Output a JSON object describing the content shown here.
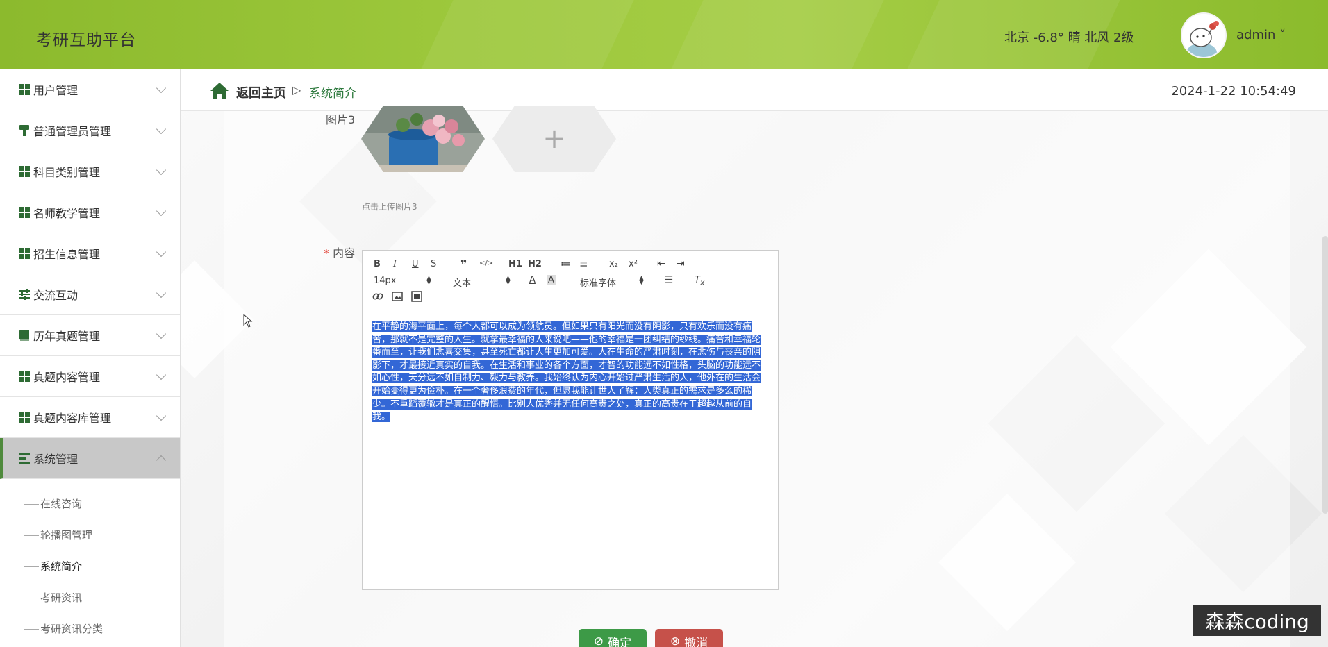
{
  "header": {
    "site_title": "考研互助平台",
    "weather": "北京  -6.8°  晴  北风  2级",
    "user_name": "admin ˅"
  },
  "sidebar": {
    "items": [
      {
        "label": "用户管理",
        "icon": "grid-icon"
      },
      {
        "label": "普通管理员管理",
        "icon": "brush-icon"
      },
      {
        "label": "科目类别管理",
        "icon": "grid-icon"
      },
      {
        "label": "名师教学管理",
        "icon": "grid-icon"
      },
      {
        "label": "招生信息管理",
        "icon": "grid-icon"
      },
      {
        "label": "交流互动",
        "icon": "sliders-icon"
      },
      {
        "label": "历年真题管理",
        "icon": "book-icon"
      },
      {
        "label": "真题内容管理",
        "icon": "grid-icon"
      },
      {
        "label": "真题内容库管理",
        "icon": "grid-icon"
      },
      {
        "label": "系统管理",
        "icon": "list-icon"
      }
    ],
    "submenu": [
      "在线咨询",
      "轮播图管理",
      "系统简介",
      "考研资讯",
      "考研资讯分类"
    ]
  },
  "breadcrumb": {
    "home": "返回主页",
    "separator": "▷",
    "current": "系统简介"
  },
  "datetime": "2024-1-22 10:54:49",
  "form": {
    "image3_label": "图片3",
    "upload_plus": "+",
    "upload_hint": "点击上传图片3",
    "content_label": "内容",
    "required_mark": "*"
  },
  "editor": {
    "toolbar_row1": [
      "B",
      "I",
      "U",
      "S",
      "❞",
      "</>",
      "H1",
      "H2",
      "≔",
      "≡",
      "x₂",
      "x²",
      "⇤",
      "⇥"
    ],
    "font_size": "14px",
    "text_type": "文本",
    "font_family": "标准字体",
    "content_lines": [
      "在平静的海平面上，每个人都可以成为领航员。但如果只有阳光而没有阴影，只有欢乐而没有痛",
      "苦，那就不是完整的人生。就拿最幸福的人来说吧——他的幸福是一团纠结的纱线。痛苦和幸福轮",
      "番而至，让我们悲喜交集，甚至死亡都让人生更加可爱。人在生命的严肃时刻，在悲伤与丧亲的阴",
      "影下，才最接近真实的自我。在生活和事业的各个方面，才智的功能远不如性格，头脑的功能远不",
      "如心性，天分远不如自制力、毅力与教养。我始终认为内心开始过严肃生活的人，他外在的生活会",
      "开始变得更为俭朴。在一个奢侈浪费的年代，但愿我能让世人了解：人类真正的需求是多么的稀",
      "少。不重蹈覆辙才是真正的醒悟。比别人优秀并无任何高贵之处，真正的高贵在于超越从前的自",
      "我。"
    ]
  },
  "buttons": {
    "confirm": "确定",
    "cancel": "撤消"
  },
  "watermark": "森森coding",
  "colors": {
    "header_green": "#9dc83c",
    "accent_green": "#3d9a47",
    "cancel_red": "#c6514a",
    "selection_blue": "#3367d6"
  }
}
